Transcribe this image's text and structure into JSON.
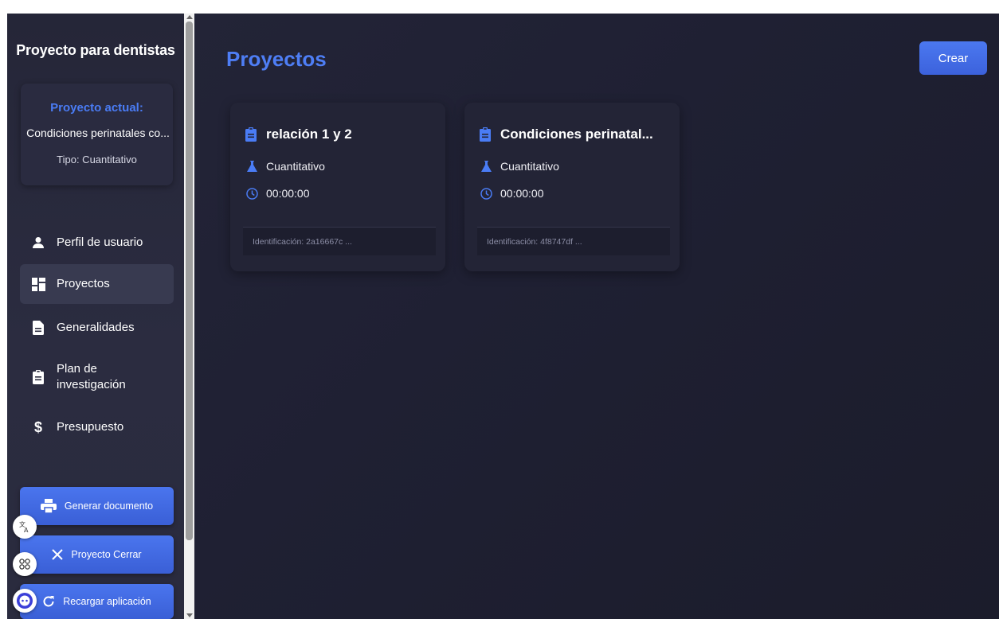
{
  "sidebar": {
    "app_title": "Proyecto para dentistas",
    "current_project": {
      "label": "Proyecto actual:",
      "name": "Condiciones perinatales co...",
      "type": "Tipo: Cuantitativo"
    },
    "nav": [
      {
        "label": "Perfil de usuario",
        "icon": "user-icon"
      },
      {
        "label": "Proyectos",
        "icon": "dashboard-icon",
        "active": true
      },
      {
        "label": "Generalidades",
        "icon": "document-icon"
      },
      {
        "label": "Plan de investigación",
        "icon": "clipboard-icon"
      },
      {
        "label": "Presupuesto",
        "icon": "dollar-icon"
      }
    ],
    "buttons": {
      "generate": "Generar documento",
      "close": "Proyecto Cerrar",
      "reload": "Recargar aplicación"
    }
  },
  "main": {
    "title": "Proyectos",
    "create_label": "Crear",
    "projects": [
      {
        "title": "relación 1 y 2",
        "type": "Cuantitativo",
        "time": "00:00:00",
        "id": "Identificación: 2a16667c ..."
      },
      {
        "title": "Condiciones perinatal...",
        "type": "Cuantitativo",
        "time": "00:00:00",
        "id": "Identificación: 4f8747df ..."
      }
    ]
  },
  "colors": {
    "accent": "#4a7cf5",
    "sidebar_bg": "#28293c",
    "main_bg": "#1f2033"
  }
}
